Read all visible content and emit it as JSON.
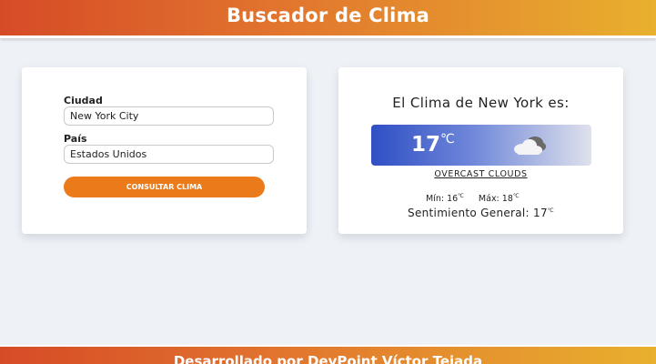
{
  "header": {
    "title": "Buscador de Clima"
  },
  "form": {
    "city_label": "Ciudad",
    "city_value": "New York City",
    "country_label": "País",
    "country_value": "Estados Unidos",
    "submit_label": "Consultar Clima"
  },
  "result": {
    "title": "El Clima de New York es:",
    "temp": "17",
    "unit": "℃",
    "icon": "cloud-icon",
    "description": "OVERCAST CLOUDS",
    "min_label": "Mín: 16",
    "max_label": "Máx: 18",
    "feels_label": "Sentimiento General: 17"
  },
  "footer": {
    "text": "Desarrollado por DevPoint Víctor Tejada"
  },
  "colors": {
    "accent": "#eb7a1b",
    "header_start": "#d64b27",
    "header_end": "#e8b02e",
    "temp_box_start": "#2f4fc4"
  }
}
